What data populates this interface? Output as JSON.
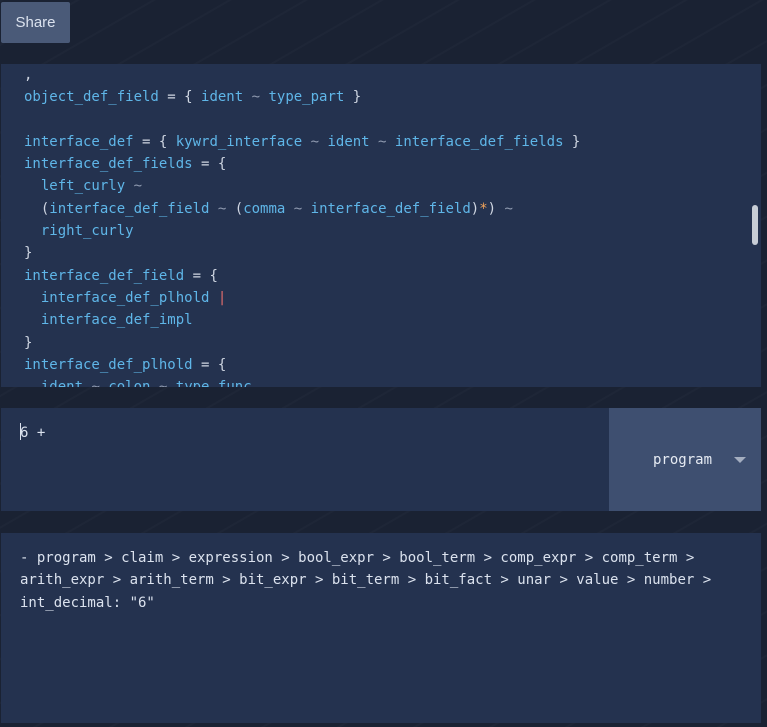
{
  "toolbar": {
    "share_label": "Share"
  },
  "editor": {
    "lines": [
      [
        {
          "t": ",",
          "c": "punct"
        }
      ],
      [
        {
          "t": "object_def_field",
          "c": "rule"
        },
        {
          "t": " = { ",
          "c": "punct"
        },
        {
          "t": "ident",
          "c": "rule"
        },
        {
          "t": " ~ ",
          "c": "op"
        },
        {
          "t": "type_part",
          "c": "rule"
        },
        {
          "t": " }",
          "c": "punct"
        }
      ],
      [],
      [
        {
          "t": "interface_def",
          "c": "rule"
        },
        {
          "t": " = { ",
          "c": "punct"
        },
        {
          "t": "kywrd_interface",
          "c": "rule"
        },
        {
          "t": " ~ ",
          "c": "op"
        },
        {
          "t": "ident",
          "c": "rule"
        },
        {
          "t": " ~ ",
          "c": "op"
        },
        {
          "t": "interface_def_fields",
          "c": "rule"
        },
        {
          "t": " }",
          "c": "punct"
        }
      ],
      [
        {
          "t": "interface_def_fields",
          "c": "rule"
        },
        {
          "t": " = {",
          "c": "punct"
        }
      ],
      [
        {
          "t": "  ",
          "c": "punct"
        },
        {
          "t": "left_curly",
          "c": "rule"
        },
        {
          "t": " ~",
          "c": "op"
        }
      ],
      [
        {
          "t": "  (",
          "c": "punct"
        },
        {
          "t": "interface_def_field",
          "c": "rule"
        },
        {
          "t": " ~ ",
          "c": "op"
        },
        {
          "t": "(",
          "c": "punct"
        },
        {
          "t": "comma",
          "c": "rule"
        },
        {
          "t": " ~ ",
          "c": "op"
        },
        {
          "t": "interface_def_field",
          "c": "rule"
        },
        {
          "t": ")",
          "c": "punct"
        },
        {
          "t": "*",
          "c": "star"
        },
        {
          "t": ")",
          "c": "punct"
        },
        {
          "t": " ~",
          "c": "op"
        }
      ],
      [
        {
          "t": "  ",
          "c": "punct"
        },
        {
          "t": "right_curly",
          "c": "rule"
        }
      ],
      [
        {
          "t": "}",
          "c": "punct"
        }
      ],
      [
        {
          "t": "interface_def_field",
          "c": "rule"
        },
        {
          "t": " = {",
          "c": "punct"
        }
      ],
      [
        {
          "t": "  ",
          "c": "punct"
        },
        {
          "t": "interface_def_plhold",
          "c": "rule"
        },
        {
          "t": " |",
          "c": "bar"
        }
      ],
      [
        {
          "t": "  ",
          "c": "punct"
        },
        {
          "t": "interface_def_impl",
          "c": "rule"
        }
      ],
      [
        {
          "t": "}",
          "c": "punct"
        }
      ],
      [
        {
          "t": "interface_def_plhold",
          "c": "rule"
        },
        {
          "t": " = {",
          "c": "punct"
        }
      ],
      [
        {
          "t": "  ",
          "c": "punct"
        },
        {
          "t": "ident",
          "c": "rule"
        },
        {
          "t": " ~ ",
          "c": "op"
        },
        {
          "t": "colon",
          "c": "rule"
        },
        {
          "t": " ~ ",
          "c": "op"
        },
        {
          "t": "type_func",
          "c": "rule"
        }
      ]
    ]
  },
  "input": {
    "value": "6 +"
  },
  "rule_select": {
    "selected": "program"
  },
  "output": {
    "text": "- program > claim > expression > bool_expr > bool_term > comp_expr > comp_term > arith_expr > arith_term > bit_expr > bit_term > bit_fact > unar > value > number > int_decimal: \"6\""
  },
  "colors": {
    "rule": "#5fb6e8",
    "punct": "#cfd6e2",
    "operator": "#8f9ab0",
    "bar": "#e06c6c",
    "star": "#f0a35a",
    "panel": "#24324f",
    "background": "#1a2233"
  }
}
